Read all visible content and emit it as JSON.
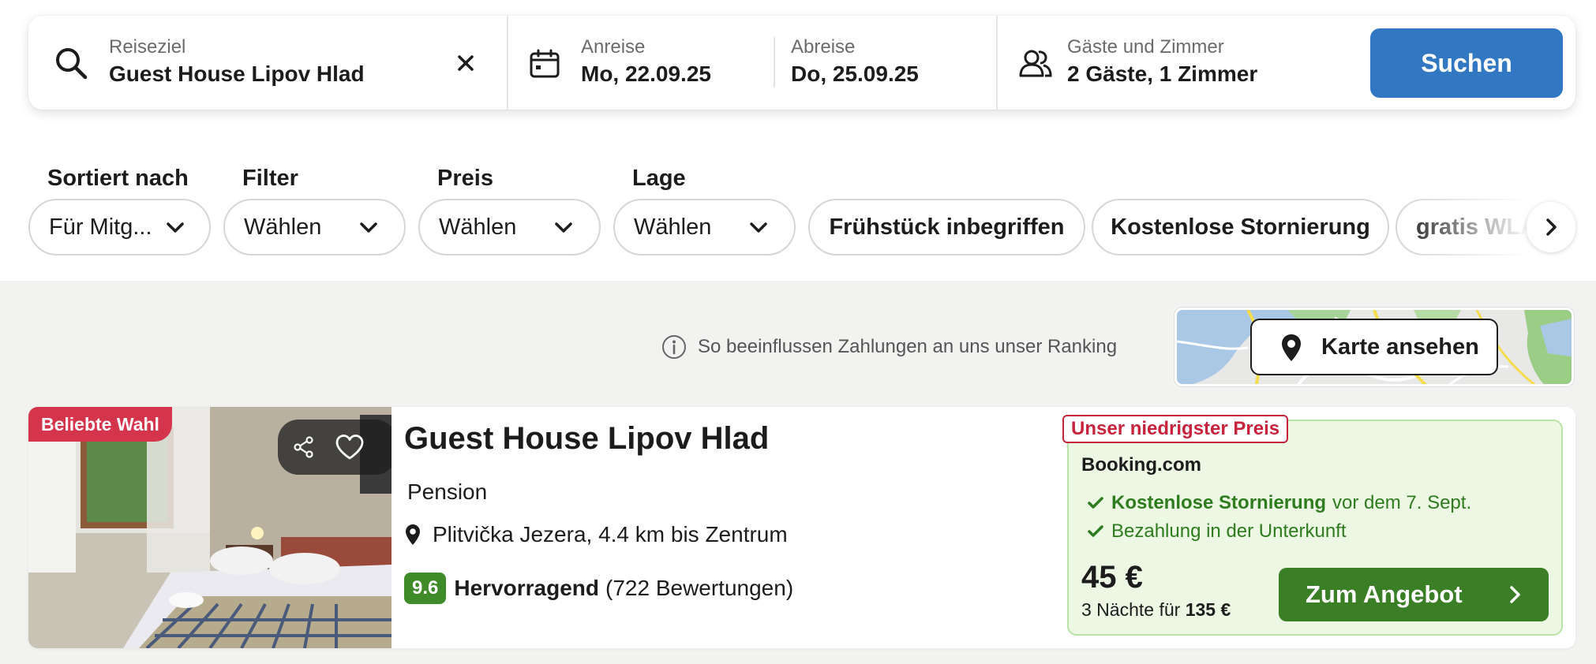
{
  "search": {
    "destination_label": "Reiseziel",
    "destination_value": "Guest House Lipov Hlad",
    "checkin_label": "Anreise",
    "checkin_value": "Mo, 22.09.25",
    "checkout_label": "Abreise",
    "checkout_value": "Do, 25.09.25",
    "guests_label": "Gäste und Zimmer",
    "guests_value": "2 Gäste, 1 Zimmer",
    "submit_label": "Suchen",
    "accent_color": "#3277c2"
  },
  "filters": {
    "sort": {
      "label": "Sortiert nach",
      "value": "Für Mitg..."
    },
    "filter": {
      "label": "Filter",
      "value": "Wählen"
    },
    "price": {
      "label": "Preis",
      "value": "Wählen"
    },
    "location": {
      "label": "Lage",
      "value": "Wählen"
    },
    "chips": [
      "Frühstück inbegriffen",
      "Kostenlose Stornierung",
      "gratis WLAN"
    ]
  },
  "ranking_info": "So beeinflussen Zahlungen an uns unser Ranking",
  "map": {
    "button_label": "Karte ansehen"
  },
  "listing": {
    "badge": "Beliebte Wahl",
    "badge_color": "#d5354c",
    "name": "Guest House Lipov Hlad",
    "type": "Pension",
    "location": "Plitvička Jezera, 4.4 km bis Zentrum",
    "score": "9.6",
    "score_color": "#3f8b2a",
    "rating_label": "Hervorragend",
    "reviews": "(722 Bewertungen)",
    "offer": {
      "tag": "Unser niedrigster Preis",
      "provider": "Booking.com",
      "feature1_bold": "Kostenlose Stornierung",
      "feature1_rest": "vor dem 7. Sept.",
      "feature2": "Bezahlung in der Unterkunft",
      "price": "45 €",
      "total_prefix": "3 Nächte für",
      "total_value": "135 €",
      "cta_label": "Zum Angebot",
      "cta_color": "#3a7f25"
    }
  }
}
